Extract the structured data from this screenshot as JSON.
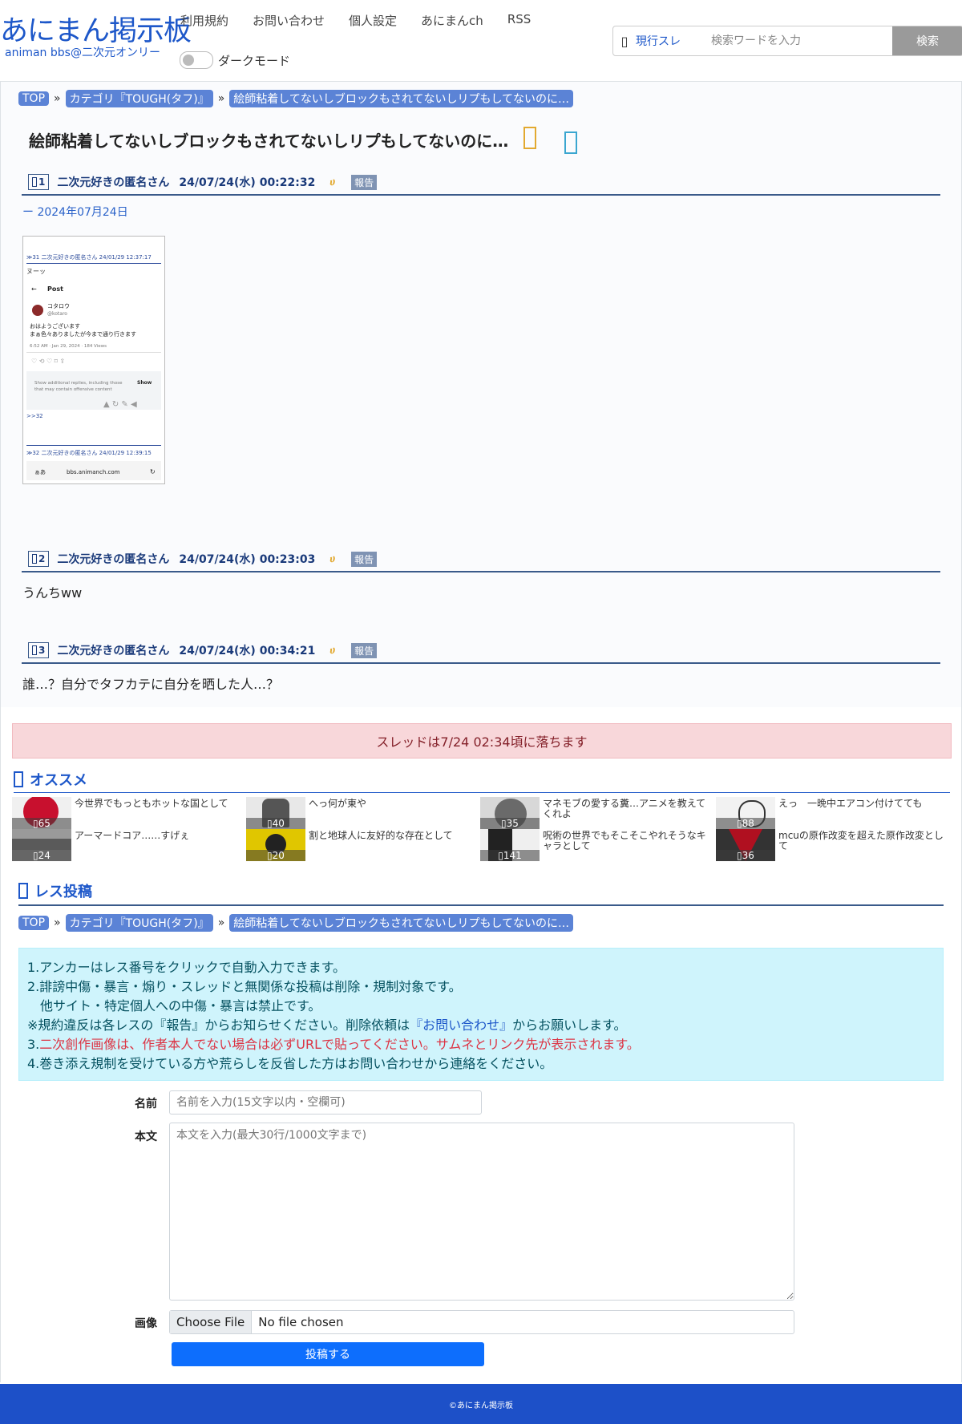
{
  "header": {
    "logo_title": "あにまん掲示板",
    "logo_subtitle": "animan bbs@二次元オンリー",
    "nav": [
      "利用規約",
      "お問い合わせ",
      "個人設定",
      "あにまんch",
      "RSS"
    ],
    "dark_mode_label": "ダークモード",
    "search_scope": "現行スレ",
    "search_placeholder": "検索ワードを入力",
    "search_button": "検索"
  },
  "breadcrumb": [
    "TOP",
    "カテゴリ『TOUGH(タフ)』",
    "絵師粘着してないしブロックもされてないしリプもしてないのに…"
  ],
  "breadcrumb_sep": "»",
  "thread": {
    "title": "絵師粘着してないしブロックもされてないしリプもしてないのに…",
    "date_line": "ー 2024年07月24日",
    "posts": [
      {
        "num": "1",
        "name": "二次元好きの匿名さん",
        "date": "24/07/24(水) 00:22:32",
        "fav": "ሀ",
        "report": "報告",
        "body": ""
      },
      {
        "num": "2",
        "name": "二次元好きの匿名さん",
        "date": "24/07/24(水) 00:23:03",
        "fav": "ሀ",
        "report": "報告",
        "body": "うんちww"
      },
      {
        "num": "3",
        "name": "二次元好きの匿名さん",
        "date": "24/07/24(水) 00:34:21",
        "fav": "ሀ",
        "report": "報告",
        "body": "誰…？自分でタフカテに自分を晒した人…？"
      }
    ],
    "image_text": {
      "top_ref": "≫31 二次元好きの匿名さん 24/01/29 12:37:17",
      "line2": "ヌーッ",
      "post_label": "Post",
      "user": "コタロウ",
      "handle": "@kotaro",
      "msg1": "おはようございます",
      "msg2": "まぁ色々ありましたが今まで通り行きます",
      "meta": "6:52 AM · Jan 29, 2024 · 184 Views",
      "hidden1": "Show additional replies, including those",
      "hidden2": "that may contain offensive content",
      "show": "Show",
      "anchor": ">>32",
      "bottom_ref": "≫32 二次元好きの匿名さん 24/01/29 12:39:15",
      "url_bar": "bbs.animanch.com",
      "aa": "ぁあ"
    }
  },
  "drop_notice": "スレッドは7/24 02:34頃に落ちます",
  "recommend": {
    "title": "オススメ",
    "items": [
      {
        "title": "今世界でもっともホットな国として",
        "count": "65"
      },
      {
        "title": "へっ何が東や",
        "count": "40"
      },
      {
        "title": "マネモブの愛する糞…アニメを教えてくれよ",
        "count": "35"
      },
      {
        "title": "えっ　一晩中エアコン付けてても",
        "count": "88"
      },
      {
        "title": "アーマードコア……すげぇ",
        "count": "24"
      },
      {
        "title": "割と地球人に友好的な存在として",
        "count": "20"
      },
      {
        "title": "呪術の世界でもそこそこやれそうなキャラとして",
        "count": "141"
      },
      {
        "title": "mcuの原作改変を超えた原作改変とし て",
        "count": "36"
      }
    ]
  },
  "reply": {
    "title": "レス投稿",
    "rules": {
      "r1": "1.アンカーはレス番号をクリックで自動入力できます。",
      "r2": "2.誹謗中傷・暴言・煽り・スレッドと無関係な投稿は削除・規制対象です。",
      "r2b": "他サイト・特定個人への中傷・暴言は禁止です。",
      "r_note_a": "※規約違反は各レスの『報告』からお知らせください。削除依頼は",
      "r_note_link": "『お問い合わせ』",
      "r_note_b": "からお願いします。",
      "r3_num": "3.",
      "r3_red": "二次創作画像は、作者本人でない場合は必ずURLで貼ってください。サムネとリンク先が表示されます。",
      "r4": "4.巻き添え規制を受けている方や荒らしを反省した方はお問い合わせから連絡をください。"
    },
    "name_label": "名前",
    "name_placeholder": "名前を入力(15文字以内・空欄可)",
    "body_label": "本文",
    "body_placeholder": "本文を入力(最大30行/1000文字まで)",
    "image_label": "画像",
    "file_button": "Choose File",
    "file_status": "No file chosen",
    "submit": "投稿する"
  },
  "footer": "©あにまん掲示板",
  "colors": {
    "brand": "#1d57c9",
    "footer": "#1d50c8",
    "alert_bg": "#f8d7da",
    "info_bg": "#cff4fc",
    "submit": "#0d6efd"
  }
}
